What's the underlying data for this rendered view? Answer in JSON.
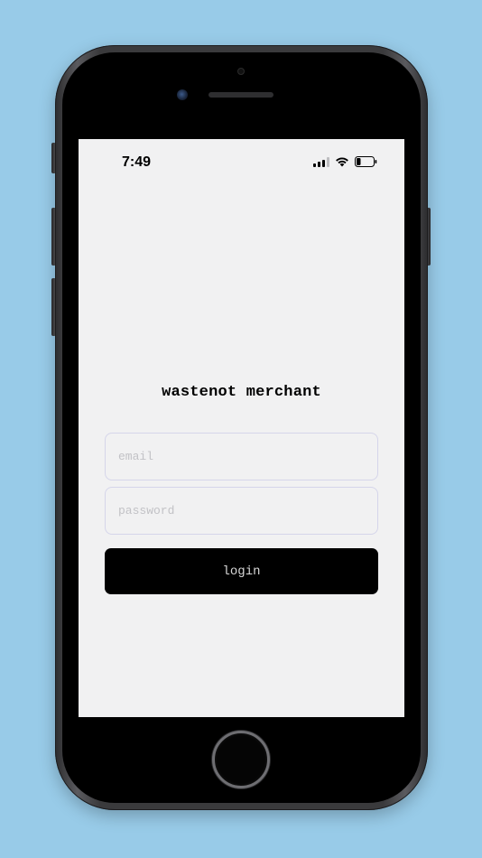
{
  "status_bar": {
    "time": "7:49",
    "icons": [
      "cellular-signal-icon",
      "wifi-icon",
      "battery-icon"
    ],
    "battery_level": 0.2
  },
  "app": {
    "title": "wastenot merchant",
    "email": {
      "value": "",
      "placeholder": "email"
    },
    "password": {
      "value": "",
      "placeholder": "password"
    },
    "login_label": "login"
  },
  "colors": {
    "background": "#98cbe8",
    "screen": "#f1f1f2",
    "button": "#000000",
    "field_border": "#d5d5ea"
  }
}
